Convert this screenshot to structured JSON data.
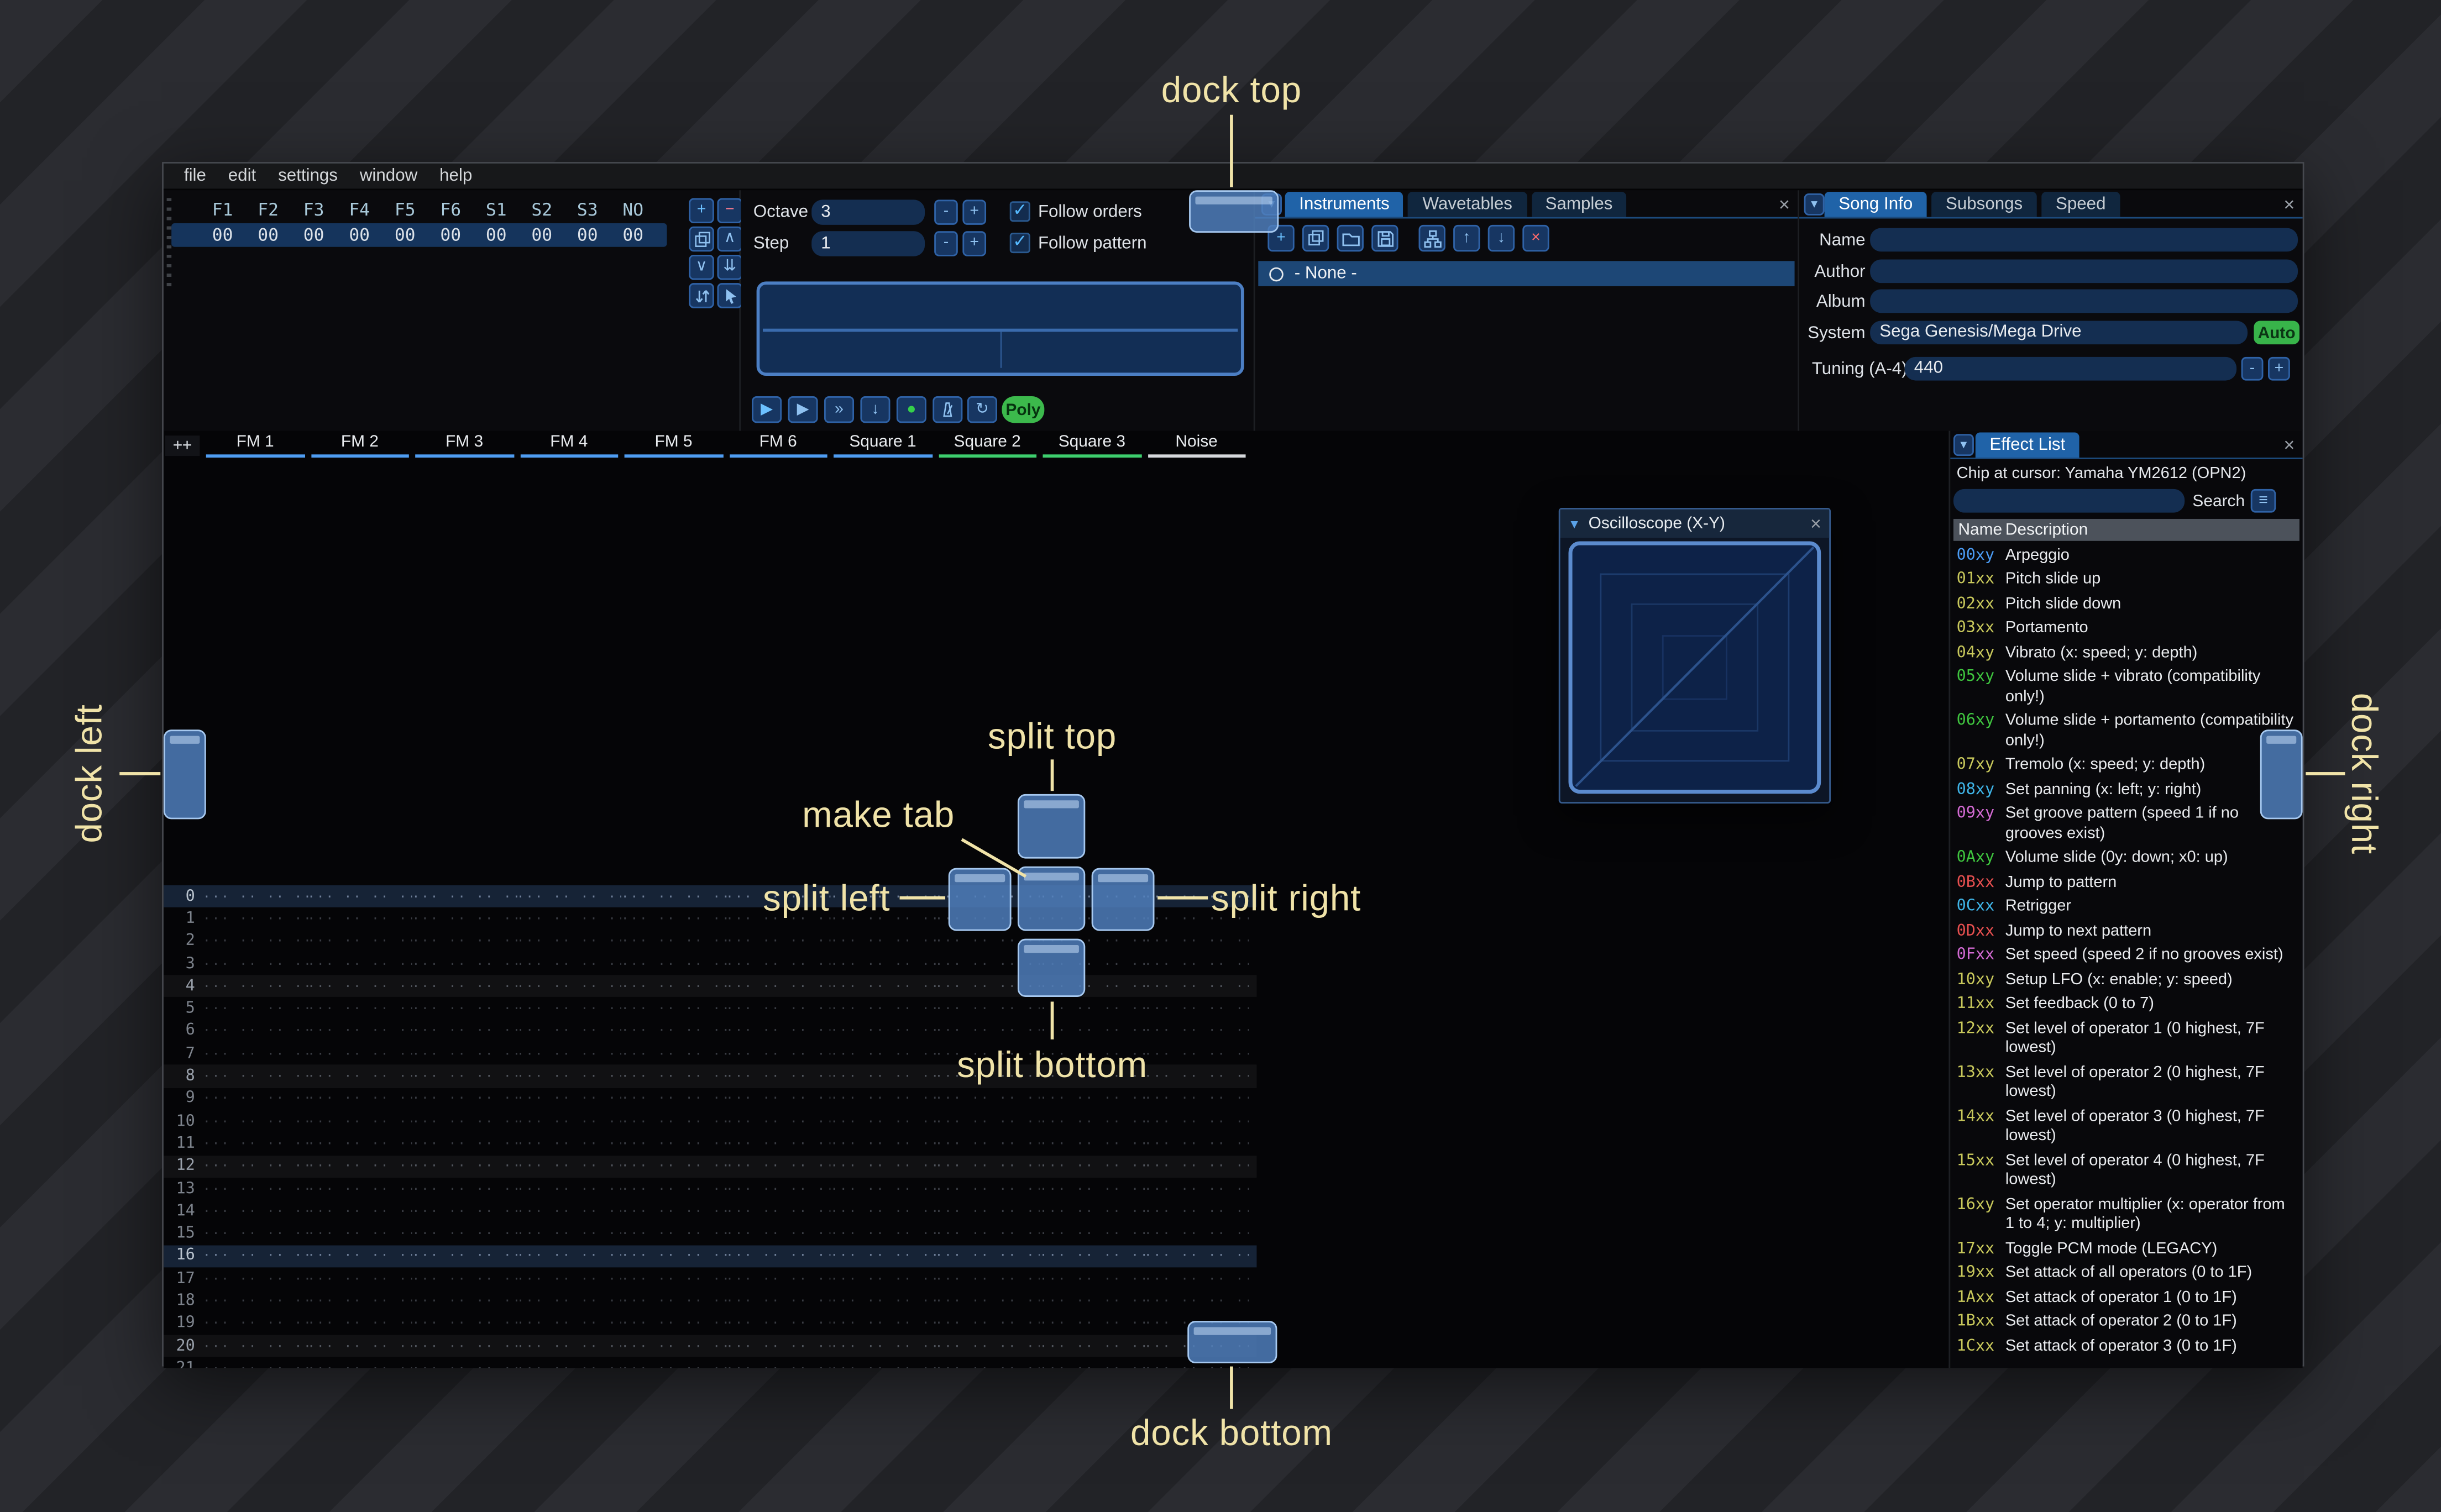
{
  "window": {
    "menu_items": [
      "file",
      "edit",
      "settings",
      "window",
      "help"
    ]
  },
  "icons": {
    "combo_arrow": "▼",
    "close": "×",
    "plus": "+",
    "minus": "−",
    "chevron_up": "∧",
    "chevron_down": "∨",
    "double_down": "⇊",
    "arrow_up": "↑",
    "arrow_down": "↓",
    "play": "▶",
    "skip": "»",
    "step_down": "↓",
    "record": "●",
    "repeat": "↻",
    "burger": "≡",
    "check": "✓",
    "collapse": "▼"
  },
  "orders": {
    "columns": [
      "F1",
      "F2",
      "F3",
      "F4",
      "F5",
      "F6",
      "S1",
      "S2",
      "S3",
      "NO"
    ],
    "values": [
      "00",
      "00",
      "00",
      "00",
      "00",
      "00",
      "00",
      "00",
      "00",
      "00"
    ]
  },
  "controls": {
    "octave_label": "Octave",
    "octave_value": "3",
    "step_label": "Step",
    "step_value": "1",
    "minus": "-",
    "plus": "+",
    "follow_orders_label": "Follow orders",
    "follow_pattern_label": "Follow pattern",
    "poly_label": "Poly"
  },
  "instruments": {
    "tabs": [
      "Instruments",
      "Wavetables",
      "Samples"
    ],
    "selected_item": "- None -"
  },
  "song_info": {
    "tabs": [
      "Song Info",
      "Subsongs",
      "Speed"
    ],
    "name_label": "Name",
    "name_value": "",
    "author_label": "Author",
    "author_value": "",
    "album_label": "Album",
    "album_value": "",
    "system_label": "System",
    "system_value": "Sega Genesis/Mega Drive",
    "auto_label": "Auto",
    "tuning_label": "Tuning (A-4)",
    "tuning_value": "440"
  },
  "pattern": {
    "corner_label": "++",
    "channels": [
      {
        "name": "FM 1",
        "color": "#4f9df2"
      },
      {
        "name": "FM 2",
        "color": "#4f9df2"
      },
      {
        "name": "FM 3",
        "color": "#4f9df2"
      },
      {
        "name": "FM 4",
        "color": "#4f9df2"
      },
      {
        "name": "FM 5",
        "color": "#4f9df2"
      },
      {
        "name": "FM 6",
        "color": "#4f9df2"
      },
      {
        "name": "Square 1",
        "color": "#4f9df2"
      },
      {
        "name": "Square 2",
        "color": "#3ecf6e"
      },
      {
        "name": "Square 3",
        "color": "#3ecf6e"
      },
      {
        "name": "Noise",
        "color": "#d6d9dc"
      }
    ],
    "row_count": 22,
    "empty_cell": "··· ·· ·· ···"
  },
  "oscilloscope": {
    "title": "Oscilloscope (X-Y)"
  },
  "effect_list": {
    "title": "Effect List",
    "chip_line": "Chip at cursor: Yamaha YM2612 (OPN2)",
    "search_label": "Search",
    "name_header": "Name",
    "description_header": "Description",
    "items": [
      {
        "code": "00xy",
        "color": "#4b9cf5",
        "desc": "Arpeggio"
      },
      {
        "code": "01xx",
        "color": "#c9c95c",
        "desc": "Pitch slide up"
      },
      {
        "code": "02xx",
        "color": "#c9c95c",
        "desc": "Pitch slide down"
      },
      {
        "code": "03xx",
        "color": "#c9c95c",
        "desc": "Portamento"
      },
      {
        "code": "04xy",
        "color": "#c9c95c",
        "desc": "Vibrato (x: speed; y: depth)"
      },
      {
        "code": "05xy",
        "color": "#3fc53f",
        "desc": "Volume slide + vibrato (compatibility only!)"
      },
      {
        "code": "06xy",
        "color": "#3fc53f",
        "desc": "Volume slide + portamento (compatibility only!)"
      },
      {
        "code": "07xy",
        "color": "#c9c95c",
        "desc": "Tremolo (x: speed; y: depth)"
      },
      {
        "code": "08xy",
        "color": "#3fb5e8",
        "desc": "Set panning (x: left; y: right)"
      },
      {
        "code": "09xy",
        "color": "#d36ad3",
        "desc": "Set groove pattern (speed 1 if no grooves exist)"
      },
      {
        "code": "0Axy",
        "color": "#3fc53f",
        "desc": "Volume slide (0y: down; x0: up)"
      },
      {
        "code": "0Bxx",
        "color": "#e85050",
        "desc": "Jump to pattern"
      },
      {
        "code": "0Cxx",
        "color": "#3fb5e8",
        "desc": "Retrigger"
      },
      {
        "code": "0Dxx",
        "color": "#e85050",
        "desc": "Jump to next pattern"
      },
      {
        "code": "0Fxx",
        "color": "#d36ad3",
        "desc": "Set speed (speed 2 if no grooves exist)"
      },
      {
        "code": "10xy",
        "color": "#c9c95c",
        "desc": "Setup LFO (x: enable; y: speed)"
      },
      {
        "code": "11xx",
        "color": "#c9c95c",
        "desc": "Set feedback (0 to 7)"
      },
      {
        "code": "12xx",
        "color": "#c9c95c",
        "desc": "Set level of operator 1 (0 highest, 7F lowest)"
      },
      {
        "code": "13xx",
        "color": "#c9c95c",
        "desc": "Set level of operator 2 (0 highest, 7F lowest)"
      },
      {
        "code": "14xx",
        "color": "#c9c95c",
        "desc": "Set level of operator 3 (0 highest, 7F lowest)"
      },
      {
        "code": "15xx",
        "color": "#c9c95c",
        "desc": "Set level of operator 4 (0 highest, 7F lowest)"
      },
      {
        "code": "16xy",
        "color": "#c9c95c",
        "desc": "Set operator multiplier (x: operator from 1 to 4; y: multiplier)"
      },
      {
        "code": "17xx",
        "color": "#c9c95c",
        "desc": "Toggle PCM mode (LEGACY)"
      },
      {
        "code": "19xx",
        "color": "#c9c95c",
        "desc": "Set attack of all operators (0 to 1F)"
      },
      {
        "code": "1Axx",
        "color": "#c9c95c",
        "desc": "Set attack of operator 1 (0 to 1F)"
      },
      {
        "code": "1Bxx",
        "color": "#c9c95c",
        "desc": "Set attack of operator 2 (0 to 1F)"
      },
      {
        "code": "1Cxx",
        "color": "#c9c95c",
        "desc": "Set attack of operator 3 (0 to 1F)"
      }
    ]
  },
  "dock": {
    "labels": {
      "top": "dock top",
      "bottom": "dock bottom",
      "left": "dock left",
      "right": "dock right",
      "split_top": "split top",
      "split_bottom": "split bottom",
      "split_left": "split left",
      "split_right": "split right",
      "make_tab": "make tab"
    }
  },
  "colors": {
    "accent": "#2063a8",
    "dock": "#4e7fbc",
    "annotation": "#f0e3a8"
  }
}
